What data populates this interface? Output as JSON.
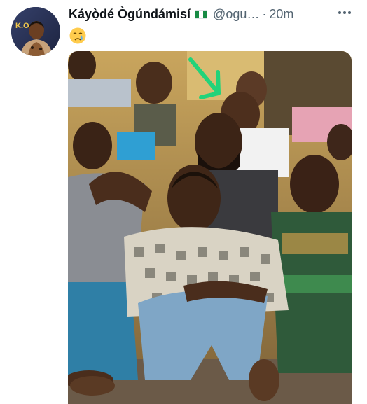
{
  "author": {
    "display_name": "Káyọ̀dé Ògúndámisí",
    "handle": "@ogu…",
    "separator": "·",
    "timestamp": "20m"
  },
  "tweet": {
    "emoji": "😢",
    "media_alt": ""
  },
  "icons": {
    "verified_flag": "nigeria-flag-icon",
    "more": "more-options-icon"
  },
  "colors": {
    "flag_green": "#178a44",
    "secondary_text": "#536471",
    "arrow_highlight": "#22d37a"
  }
}
